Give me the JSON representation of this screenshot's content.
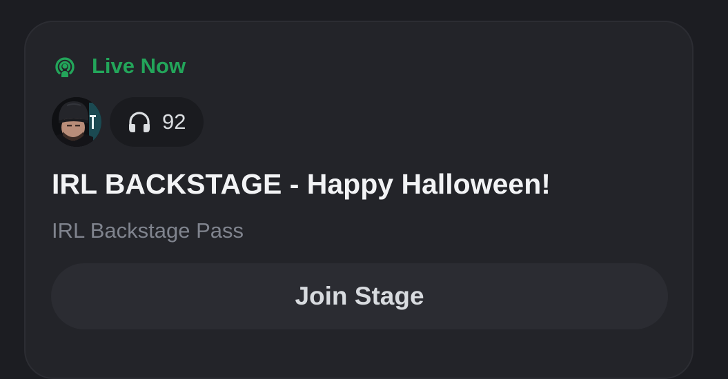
{
  "colors": {
    "page_background": "#1c1d22",
    "card_background": "#232429",
    "live_green": "#23a55a",
    "title_text": "#f2f3f5",
    "subtitle_text": "#80848e",
    "button_background": "#2b2c32"
  },
  "status": {
    "icon": "live-stage-icon",
    "label": "Live Now"
  },
  "listeners": {
    "icon": "headphones-icon",
    "count": "92"
  },
  "stage": {
    "title": "IRL BACKSTAGE - Happy Halloween!",
    "subtitle": "IRL Backstage Pass"
  },
  "actions": {
    "join_label": "Join Stage"
  }
}
